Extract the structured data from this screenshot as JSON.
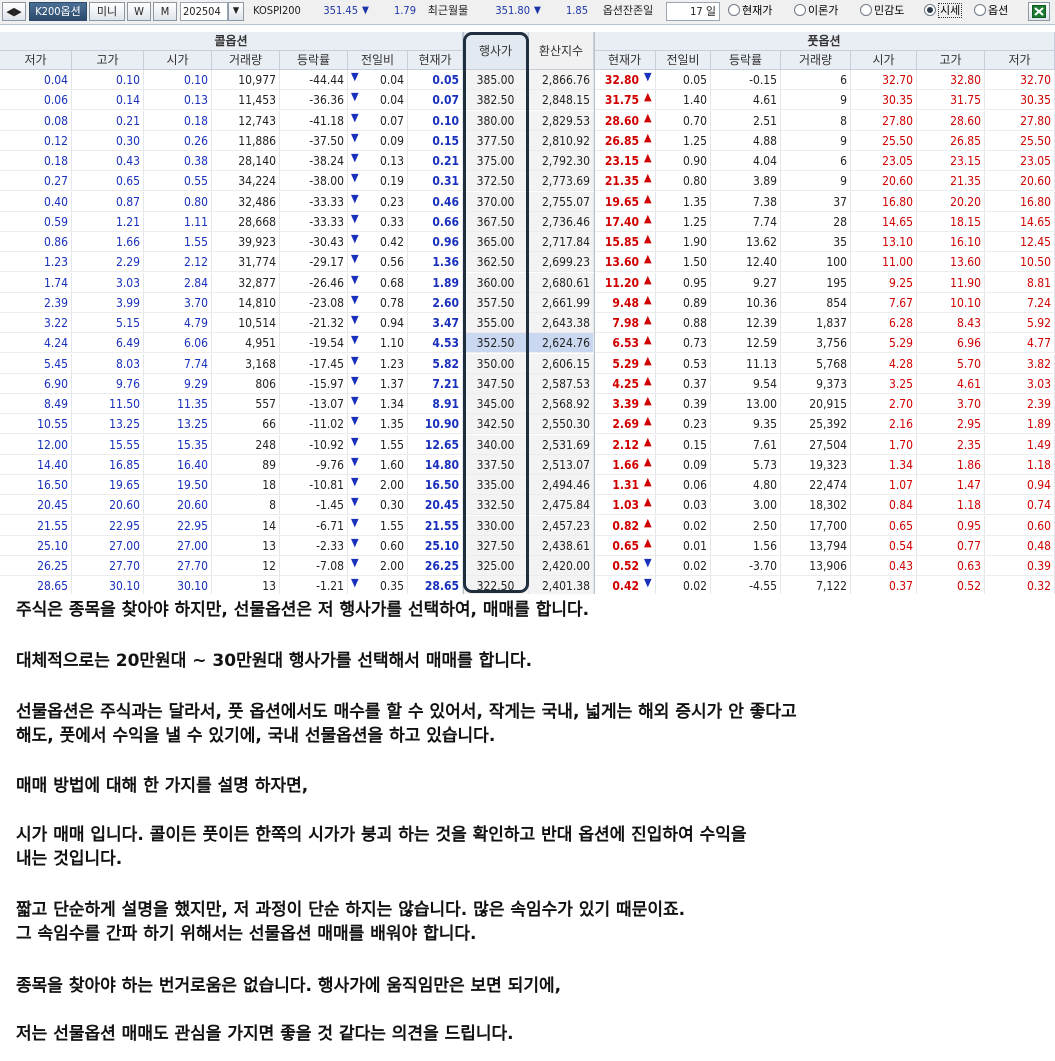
{
  "toolbar": {
    "nav_arrows": "◀▶",
    "product": "K200옵션",
    "mini": "미니",
    "weekly": "W",
    "monthly": "M",
    "expiry": "202504",
    "index_label": "KOSPI200",
    "index_value": "351.45",
    "index_change": "1.79",
    "futures_label": "최근월물",
    "futures_value": "351.80",
    "futures_change": "1.85",
    "days_label": "옵션잔존일",
    "days_value": "17",
    "days_unit": "일",
    "view_options": [
      {
        "label": "현재가",
        "selected": false
      },
      {
        "label": "이론가",
        "selected": false
      },
      {
        "label": "민감도",
        "selected": false
      },
      {
        "label": "시세",
        "selected": true
      },
      {
        "label": "옵션",
        "selected": false
      }
    ],
    "excel_icon": "excel-icon"
  },
  "grid": {
    "call_title": "콜옵션",
    "put_title": "풋옵션",
    "strike_header": "행사가",
    "conv_header": "환산지수",
    "call_columns": [
      "저가",
      "고가",
      "시가",
      "거래량",
      "등락률",
      "전일비",
      "현재가"
    ],
    "put_columns": [
      "현재가",
      "전일비",
      "등락률",
      "거래량",
      "시가",
      "고가",
      "저가"
    ],
    "atm_strike": "352.50",
    "rows": [
      {
        "c": [
          "0.04",
          "0.10",
          "0.10",
          "10,977",
          "-44.44",
          "0.04",
          "0.05"
        ],
        "cd": "dn",
        "k": "385.00",
        "x": "2,866.76",
        "p": [
          "32.80",
          "0.05",
          "-0.15",
          "6",
          "32.70",
          "32.80",
          "32.70"
        ],
        "pd": "dn"
      },
      {
        "c": [
          "0.06",
          "0.14",
          "0.13",
          "11,453",
          "-36.36",
          "0.04",
          "0.07"
        ],
        "cd": "dn",
        "k": "382.50",
        "x": "2,848.15",
        "p": [
          "31.75",
          "1.40",
          "4.61",
          "9",
          "30.35",
          "31.75",
          "30.35"
        ],
        "pd": "up"
      },
      {
        "c": [
          "0.08",
          "0.21",
          "0.18",
          "12,743",
          "-41.18",
          "0.07",
          "0.10"
        ],
        "cd": "dn",
        "k": "380.00",
        "x": "2,829.53",
        "p": [
          "28.60",
          "0.70",
          "2.51",
          "8",
          "27.80",
          "28.60",
          "27.80"
        ],
        "pd": "up"
      },
      {
        "c": [
          "0.12",
          "0.30",
          "0.26",
          "11,886",
          "-37.50",
          "0.09",
          "0.15"
        ],
        "cd": "dn",
        "k": "377.50",
        "x": "2,810.92",
        "p": [
          "26.85",
          "1.25",
          "4.88",
          "9",
          "25.50",
          "26.85",
          "25.50"
        ],
        "pd": "up"
      },
      {
        "c": [
          "0.18",
          "0.43",
          "0.38",
          "28,140",
          "-38.24",
          "0.13",
          "0.21"
        ],
        "cd": "dn",
        "k": "375.00",
        "x": "2,792.30",
        "p": [
          "23.15",
          "0.90",
          "4.04",
          "6",
          "23.05",
          "23.15",
          "23.05"
        ],
        "pd": "up"
      },
      {
        "c": [
          "0.27",
          "0.65",
          "0.55",
          "34,224",
          "-38.00",
          "0.19",
          "0.31"
        ],
        "cd": "dn",
        "k": "372.50",
        "x": "2,773.69",
        "p": [
          "21.35",
          "0.80",
          "3.89",
          "9",
          "20.60",
          "21.35",
          "20.60"
        ],
        "pd": "up"
      },
      {
        "c": [
          "0.40",
          "0.87",
          "0.80",
          "32,486",
          "-33.33",
          "0.23",
          "0.46"
        ],
        "cd": "dn",
        "k": "370.00",
        "x": "2,755.07",
        "p": [
          "19.65",
          "1.35",
          "7.38",
          "37",
          "16.80",
          "20.20",
          "16.80"
        ],
        "pd": "up"
      },
      {
        "c": [
          "0.59",
          "1.21",
          "1.11",
          "28,668",
          "-33.33",
          "0.33",
          "0.66"
        ],
        "cd": "dn",
        "k": "367.50",
        "x": "2,736.46",
        "p": [
          "17.40",
          "1.25",
          "7.74",
          "28",
          "14.65",
          "18.15",
          "14.65"
        ],
        "pd": "up"
      },
      {
        "c": [
          "0.86",
          "1.66",
          "1.55",
          "39,923",
          "-30.43",
          "0.42",
          "0.96"
        ],
        "cd": "dn",
        "k": "365.00",
        "x": "2,717.84",
        "p": [
          "15.85",
          "1.90",
          "13.62",
          "35",
          "13.10",
          "16.10",
          "12.45"
        ],
        "pd": "up"
      },
      {
        "c": [
          "1.23",
          "2.29",
          "2.12",
          "31,774",
          "-29.17",
          "0.56",
          "1.36"
        ],
        "cd": "dn",
        "k": "362.50",
        "x": "2,699.23",
        "p": [
          "13.60",
          "1.50",
          "12.40",
          "100",
          "11.00",
          "13.60",
          "10.50"
        ],
        "pd": "up"
      },
      {
        "c": [
          "1.74",
          "3.03",
          "2.84",
          "32,877",
          "-26.46",
          "0.68",
          "1.89"
        ],
        "cd": "dn",
        "k": "360.00",
        "x": "2,680.61",
        "p": [
          "11.20",
          "0.95",
          "9.27",
          "195",
          "9.25",
          "11.90",
          "8.81"
        ],
        "pd": "up"
      },
      {
        "c": [
          "2.39",
          "3.99",
          "3.70",
          "14,810",
          "-23.08",
          "0.78",
          "2.60"
        ],
        "cd": "dn",
        "k": "357.50",
        "x": "2,661.99",
        "p": [
          "9.48",
          "0.89",
          "10.36",
          "854",
          "7.67",
          "10.10",
          "7.24"
        ],
        "pd": "up"
      },
      {
        "c": [
          "3.22",
          "5.15",
          "4.79",
          "10,514",
          "-21.32",
          "0.94",
          "3.47"
        ],
        "cd": "dn",
        "k": "355.00",
        "x": "2,643.38",
        "p": [
          "7.98",
          "0.88",
          "12.39",
          "1,837",
          "6.28",
          "8.43",
          "5.92"
        ],
        "pd": "up"
      },
      {
        "c": [
          "4.24",
          "6.49",
          "6.06",
          "4,951",
          "-19.54",
          "1.10",
          "4.53"
        ],
        "cd": "dn",
        "k": "352.50",
        "x": "2,624.76",
        "p": [
          "6.53",
          "0.73",
          "12.59",
          "3,756",
          "5.29",
          "6.96",
          "4.77"
        ],
        "pd": "up"
      },
      {
        "c": [
          "5.45",
          "8.03",
          "7.74",
          "3,168",
          "-17.45",
          "1.23",
          "5.82"
        ],
        "cd": "dn",
        "k": "350.00",
        "x": "2,606.15",
        "p": [
          "5.29",
          "0.53",
          "11.13",
          "5,768",
          "4.28",
          "5.70",
          "3.82"
        ],
        "pd": "up"
      },
      {
        "c": [
          "6.90",
          "9.76",
          "9.29",
          "806",
          "-15.97",
          "1.37",
          "7.21"
        ],
        "cd": "dn",
        "k": "347.50",
        "x": "2,587.53",
        "p": [
          "4.25",
          "0.37",
          "9.54",
          "9,373",
          "3.25",
          "4.61",
          "3.03"
        ],
        "pd": "up"
      },
      {
        "c": [
          "8.49",
          "11.50",
          "11.35",
          "557",
          "-13.07",
          "1.34",
          "8.91"
        ],
        "cd": "dn",
        "k": "345.00",
        "x": "2,568.92",
        "p": [
          "3.39",
          "0.39",
          "13.00",
          "20,915",
          "2.70",
          "3.70",
          "2.39"
        ],
        "pd": "up"
      },
      {
        "c": [
          "10.55",
          "13.25",
          "13.25",
          "66",
          "-11.02",
          "1.35",
          "10.90"
        ],
        "cd": "dn",
        "k": "342.50",
        "x": "2,550.30",
        "p": [
          "2.69",
          "0.23",
          "9.35",
          "25,392",
          "2.16",
          "2.95",
          "1.89"
        ],
        "pd": "up"
      },
      {
        "c": [
          "12.00",
          "15.55",
          "15.35",
          "248",
          "-10.92",
          "1.55",
          "12.65"
        ],
        "cd": "dn",
        "k": "340.00",
        "x": "2,531.69",
        "p": [
          "2.12",
          "0.15",
          "7.61",
          "27,504",
          "1.70",
          "2.35",
          "1.49"
        ],
        "pd": "up"
      },
      {
        "c": [
          "14.40",
          "16.85",
          "16.40",
          "89",
          "-9.76",
          "1.60",
          "14.80"
        ],
        "cd": "dn",
        "k": "337.50",
        "x": "2,513.07",
        "p": [
          "1.66",
          "0.09",
          "5.73",
          "19,323",
          "1.34",
          "1.86",
          "1.18"
        ],
        "pd": "up"
      },
      {
        "c": [
          "16.50",
          "19.65",
          "19.50",
          "18",
          "-10.81",
          "2.00",
          "16.50"
        ],
        "cd": "dn",
        "k": "335.00",
        "x": "2,494.46",
        "p": [
          "1.31",
          "0.06",
          "4.80",
          "22,474",
          "1.07",
          "1.47",
          "0.94"
        ],
        "pd": "up"
      },
      {
        "c": [
          "20.45",
          "20.60",
          "20.60",
          "8",
          "-1.45",
          "0.30",
          "20.45"
        ],
        "cd": "dn",
        "k": "332.50",
        "x": "2,475.84",
        "p": [
          "1.03",
          "0.03",
          "3.00",
          "18,302",
          "0.84",
          "1.18",
          "0.74"
        ],
        "pd": "up"
      },
      {
        "c": [
          "21.55",
          "22.95",
          "22.95",
          "14",
          "-6.71",
          "1.55",
          "21.55"
        ],
        "cd": "dn",
        "k": "330.00",
        "x": "2,457.23",
        "p": [
          "0.82",
          "0.02",
          "2.50",
          "17,700",
          "0.65",
          "0.95",
          "0.60"
        ],
        "pd": "up"
      },
      {
        "c": [
          "25.10",
          "27.00",
          "27.00",
          "13",
          "-2.33",
          "0.60",
          "25.10"
        ],
        "cd": "dn",
        "k": "327.50",
        "x": "2,438.61",
        "p": [
          "0.65",
          "0.01",
          "1.56",
          "13,794",
          "0.54",
          "0.77",
          "0.48"
        ],
        "pd": "up"
      },
      {
        "c": [
          "26.25",
          "27.70",
          "27.70",
          "12",
          "-7.08",
          "2.00",
          "26.25"
        ],
        "cd": "dn",
        "k": "325.00",
        "x": "2,420.00",
        "p": [
          "0.52",
          "0.02",
          "-3.70",
          "13,906",
          "0.43",
          "0.63",
          "0.39"
        ],
        "pd": "dn"
      },
      {
        "c": [
          "28.65",
          "30.10",
          "30.10",
          "13",
          "-1.21",
          "0.35",
          "28.65"
        ],
        "cd": "dn",
        "k": "322.50",
        "x": "2,401.38",
        "p": [
          "0.42",
          "0.02",
          "-4.55",
          "7,122",
          "0.37",
          "0.52",
          "0.32"
        ],
        "pd": "dn"
      }
    ]
  },
  "article": {
    "paragraphs": [
      [
        "주식은 종목을 찾아야 하지만, 선물옵션은 저 행사가를 선택하여, 매매를 합니다."
      ],
      [
        "대체적으로는 20만원대 ~ 30만원대 행사가를 선택해서 매매를 합니다."
      ],
      [
        "선물옵션은 주식과는 달라서, 풋 옵션에서도 매수를 할 수 있어서, 작게는 국내, 넓게는 해외 증시가 안 좋다고",
        "해도, 풋에서 수익을 낼 수 있기에, 국내 선물옵션을 하고 있습니다."
      ],
      [
        "매매 방법에 대해 한 가지를  설명 하자면,"
      ],
      [
        "시가 매매 입니다. 콜이든 풋이든 한쪽의 시가가 붕괴 하는 것을 확인하고 반대 옵션에 진입하여 수익을",
        "내는 것입니다."
      ],
      [
        "짧고 단순하게 설명을 했지만, 저 과정이 단순 하지는 않습니다. 많은 속임수가 있기 때문이죠.",
        "그 속임수를 간파 하기 위해서는 선물옵션 매매를 배워야 합니다."
      ],
      [
        "종목을 찾아야 하는 번거로움은 없습니다. 행사가에 움직임만은 보면 되기에,"
      ],
      [
        "저는 선물옵션 매매도 관심을 가지면 좋을 것 같다는 의견을 드립니다."
      ]
    ]
  },
  "colors": {
    "call_price": "#1930bd",
    "put_price": "#d10000",
    "header_bg": "#e9eef4",
    "atm_highlight": "#c9d8f0",
    "strike_frame": "#1f2e3e"
  }
}
